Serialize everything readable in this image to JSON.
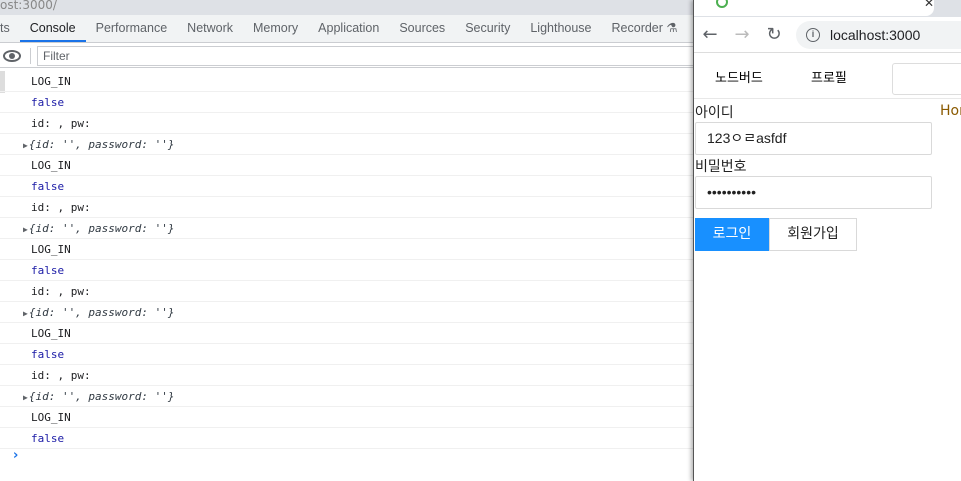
{
  "devtools": {
    "url_fragment": "ost:3000/",
    "tabs": [
      "ts",
      "Console",
      "Performance",
      "Network",
      "Memory",
      "Application",
      "Sources",
      "Security",
      "Lighthouse",
      "Recorder ⚗"
    ],
    "filter_placeholder": "Filter",
    "rows": [
      {
        "type": "text",
        "text": "LOG_IN"
      },
      {
        "type": "bool",
        "text": "false"
      },
      {
        "type": "text",
        "text": "id: , pw:"
      },
      {
        "type": "obj",
        "text": "{id: '', password: ''}"
      },
      {
        "type": "text",
        "text": "LOG_IN"
      },
      {
        "type": "bool",
        "text": "false"
      },
      {
        "type": "text",
        "text": "id: , pw:"
      },
      {
        "type": "obj",
        "text": "{id: '', password: ''}"
      },
      {
        "type": "text",
        "text": "LOG_IN"
      },
      {
        "type": "bool",
        "text": "false"
      },
      {
        "type": "text",
        "text": "id: , pw:"
      },
      {
        "type": "obj",
        "text": "{id: '', password: ''}"
      },
      {
        "type": "text",
        "text": "LOG_IN"
      },
      {
        "type": "bool",
        "text": "false"
      },
      {
        "type": "text",
        "text": "id: , pw:"
      },
      {
        "type": "obj",
        "text": "{id: '', password: ''}"
      },
      {
        "type": "text",
        "text": "LOG_IN"
      },
      {
        "type": "bool",
        "text": "false"
      }
    ],
    "prompt": "›"
  },
  "browser": {
    "address": "localhost:3000",
    "menu": [
      "노드버드",
      "프로필"
    ],
    "id_label": "아이디",
    "id_value": "123ㅇㄹasfdf",
    "pw_label": "비밀번호",
    "pw_value": "••••••••••",
    "login_button": "로그인",
    "signup_button": "회원가입",
    "side_text": "Hor"
  }
}
